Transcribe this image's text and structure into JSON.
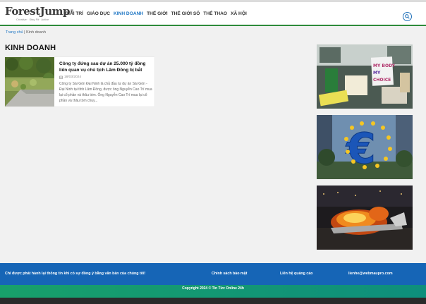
{
  "logo": {
    "word": "ForestJump",
    "tm": "®",
    "tagline": "Creative · Stay Fit · Active"
  },
  "nav": [
    {
      "label": "Giải trí"
    },
    {
      "label": "Giáo dục"
    },
    {
      "label": "Kinh doanh",
      "active": true
    },
    {
      "label": "Thế giới"
    },
    {
      "label": "Thế giới số"
    },
    {
      "label": "Thể thao"
    },
    {
      "label": "Xã hội"
    }
  ],
  "breadcrumb": {
    "home": "Trang chủ",
    "separator": " | ",
    "current": "Kinh doanh"
  },
  "section_title": "KINH DOANH",
  "article": {
    "title": "Công ty đứng sau dự án 25.000 tỷ đồng liên quan vụ chủ tịch Lâm Đồng bị bắt",
    "date": "18/03/2024",
    "excerpt": "Công ty Sài Gòn Đại Ninh là chủ đầu tư dự án Sài Gòn - Đại Ninh tại tỉnh Lâm Đồng, được ông Nguyễn Cao Trí mua lại cổ phần và thâu tóm. Ông Nguyễn Cao Trí mua lại cổ phần và thâu tóm chuy..."
  },
  "sidebar_images": [
    {
      "name": "protest-signs-image",
      "sign_text": "MY BODY MY CHOICE"
    },
    {
      "name": "euro-sign-image",
      "sign_text": "€"
    },
    {
      "name": "burning-plane-image",
      "sign_text": ""
    }
  ],
  "footer": {
    "notice": "Chỉ được phát hành lại thông tin khi có sự đồng ý bằng văn bản của chúng tôi!",
    "privacy": "Chính sách bảo mật",
    "ads": "Liên hệ quảng cáo",
    "email": "lienhe@webmaupro.com",
    "copyright": "Copyright 2024 © Tin Tức Online 24h"
  },
  "colors": {
    "accent": "#1d75c3",
    "footer_blue": "#1665b6",
    "footer_green": "#18a06a",
    "header_line": "#2e8b3a"
  }
}
